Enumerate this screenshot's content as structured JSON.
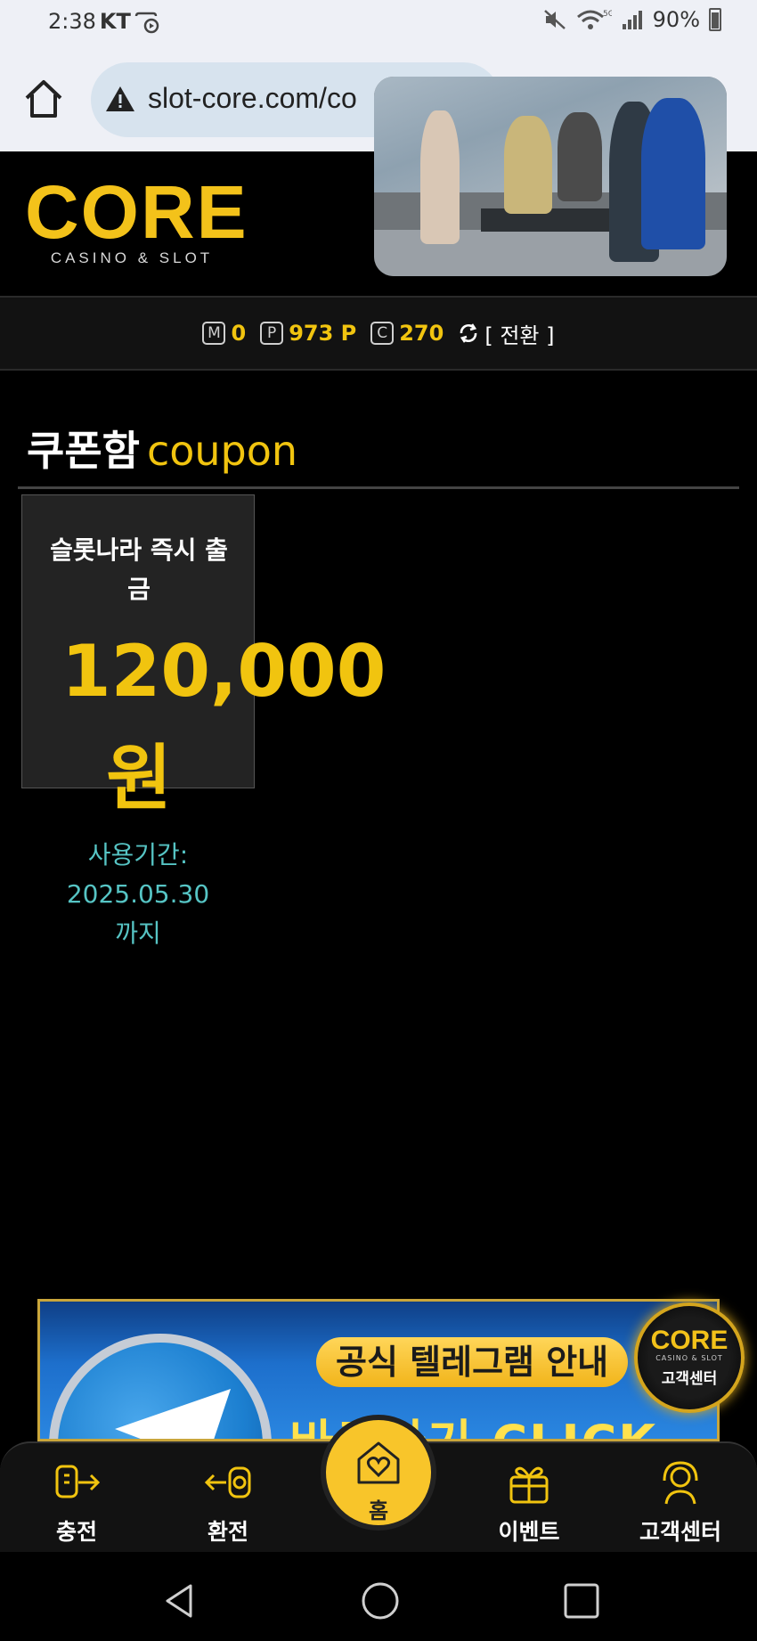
{
  "status_bar": {
    "time": "2:38",
    "carrier": "KT",
    "battery": "90%",
    "network": "5G"
  },
  "browser": {
    "url": "slot-core.com/co"
  },
  "header": {
    "logo_text": "CORE",
    "logo_subtitle": "CASINO & SLOT"
  },
  "balance": {
    "money_badge": "M",
    "money": "0",
    "point_badge": "P",
    "point": "973 P",
    "coin_badge": "C",
    "coin": "270",
    "switch_label": "[ 전환 ]"
  },
  "page": {
    "title_ko": "쿠폰함",
    "title_en": "coupon"
  },
  "coupon": {
    "name": "슬롯나라 즉시 출금",
    "amount": "120,000",
    "unit": "원",
    "expiry_line1": "사용기간:",
    "expiry_line2": "2025.05.30",
    "expiry_line3": "까지"
  },
  "banner": {
    "title": "공식 텔레그램 안내",
    "cta": "바로가기 CLICK"
  },
  "cs_float": {
    "logo": "CORE",
    "sub": "CASINO & SLOT",
    "label": "고객센터"
  },
  "bottom_nav": {
    "charge": "충전",
    "exchange": "환전",
    "home": "홈",
    "event": "이벤트",
    "support": "고객센터"
  },
  "colors": {
    "accent_gold": "#f1c40f",
    "expiry_teal": "#56c4c4",
    "background": "#000000"
  }
}
